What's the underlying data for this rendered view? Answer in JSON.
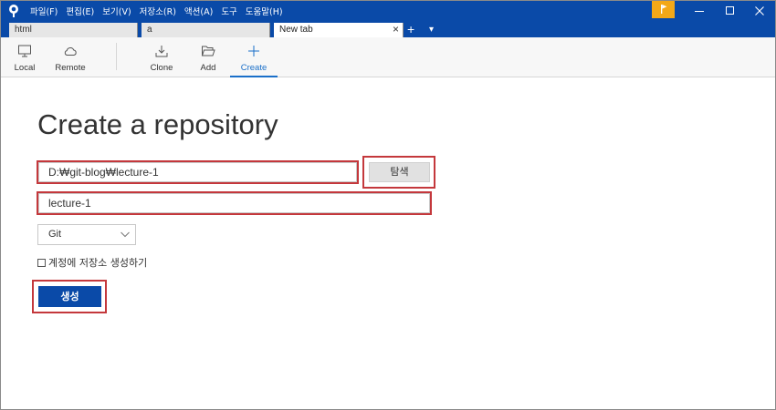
{
  "menu": [
    "파일(F)",
    "편집(E)",
    "보기(V)",
    "저장소(R)",
    "액션(A)",
    "도구",
    "도움말(H)"
  ],
  "tabs": [
    {
      "label": "html"
    },
    {
      "label": "a"
    },
    {
      "label": "New tab",
      "close": "×"
    }
  ],
  "tabbar": {
    "add_label": "+",
    "dropdown_label": "▾"
  },
  "toolbar": {
    "local": "Local",
    "remote": "Remote",
    "clone": "Clone",
    "add": "Add",
    "create": "Create"
  },
  "page": {
    "title": "Create a repository",
    "path_value": "D:₩git-blog₩lecture-1",
    "browse_label": "탐색",
    "name_value": "lecture-1",
    "repo_type": "Git",
    "account_checkbox_label": "계정에 저장소 생성하기",
    "create_button": "생성"
  },
  "colors": {
    "brand": "#0a4aa8",
    "highlight": "#c4383c",
    "flag": "#f3a818",
    "selected_tab_accent": "#1a6fc9"
  }
}
